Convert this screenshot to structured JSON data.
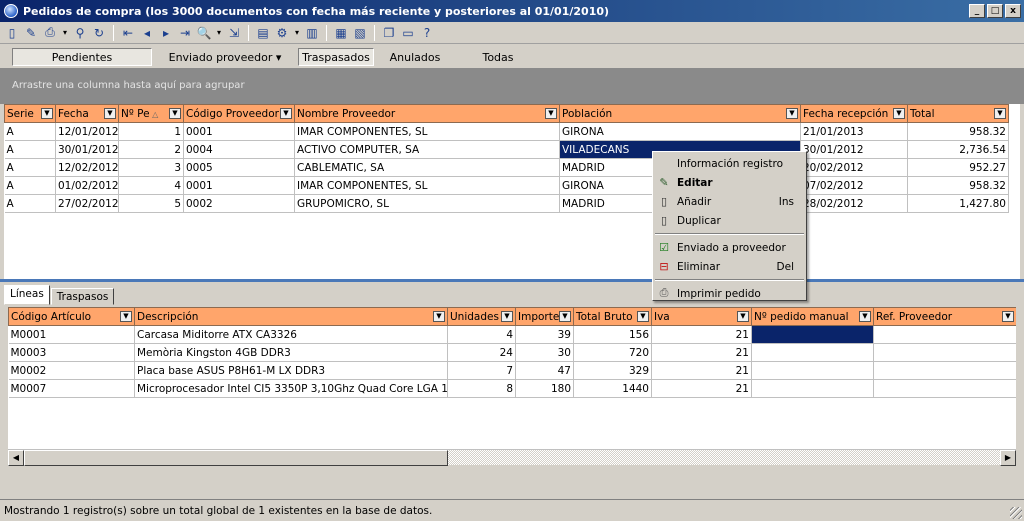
{
  "window": {
    "title": "Pedidos de compra (los 3000 documentos con fecha más reciente y posteriores al 01/01/2010)",
    "controls": [
      "_",
      "□",
      "x"
    ]
  },
  "toolbar_icons": [
    "new-doc-icon",
    "edit-icon",
    "print-icon",
    "caret",
    "link-icon",
    "refresh-icon",
    "sep",
    "first-icon",
    "prev-icon",
    "next-icon",
    "last-icon",
    "preview-icon",
    "caret",
    "export-icon",
    "sep",
    "report-icon",
    "tools-icon",
    "caret",
    "columns-icon",
    "sep",
    "grid-icon",
    "layout-icon",
    "sep",
    "window-icon",
    "window2-icon",
    "help-icon"
  ],
  "filter_tabs": [
    {
      "label": "Pendientes",
      "active": true
    },
    {
      "label": "Enviado proveedor ▾",
      "active": false
    },
    {
      "label": "Traspasados",
      "active": true
    },
    {
      "label": "Anulados",
      "active": false
    },
    {
      "label": "Todas",
      "active": false
    }
  ],
  "groupbar_text": "Arrastre una columna hasta aquí para agrupar",
  "orders": {
    "columns": [
      "Serie",
      "Fecha",
      "Nº Pe",
      "Código Proveedor",
      "Nombre Proveedor",
      "Población",
      "Fecha recepción",
      "Total"
    ],
    "sort_indicator": "△",
    "rows": [
      [
        "A",
        "12/01/2012",
        "1",
        "0001",
        "IMAR COMPONENTES, SL",
        "GIRONA",
        "21/01/2013",
        "958.32"
      ],
      [
        "A",
        "30/01/2012",
        "2",
        "0004",
        "ACTIVO COMPUTER, SA",
        "VILADECANS",
        "30/01/2012",
        "2,736.54"
      ],
      [
        "A",
        "12/02/2012",
        "3",
        "0005",
        "CABLEMATIC, SA",
        "MADRID",
        "20/02/2012",
        "952.27"
      ],
      [
        "A",
        "01/02/2012",
        "4",
        "0001",
        "IMAR COMPONENTES, SL",
        "GIRONA",
        "07/02/2012",
        "958.32"
      ],
      [
        "A",
        "27/02/2012",
        "5",
        "0002",
        "GRUPOMICRO, SL",
        "MADRID",
        "28/02/2012",
        "1,427.80"
      ]
    ]
  },
  "sub_tabs": [
    {
      "label": "Líneas",
      "active": true
    },
    {
      "label": "Traspasos",
      "active": false
    }
  ],
  "lines": {
    "columns": [
      "Código Artículo",
      "Descripción",
      "Unidades",
      "Importe",
      "Total Bruto",
      "Iva",
      "Nº pedido manual",
      "Ref. Proveedor"
    ],
    "rows": [
      [
        "M0001",
        "Carcasa Miditorre ATX CA3326",
        "4",
        "39",
        "156",
        "21",
        "",
        ""
      ],
      [
        "M0003",
        "Memòria Kingston 4GB DDR3",
        "24",
        "30",
        "720",
        "21",
        "",
        ""
      ],
      [
        "M0002",
        "Placa base ASUS P8H61-M LX DDR3",
        "7",
        "47",
        "329",
        "21",
        "",
        ""
      ],
      [
        "M0007",
        "Microprocesador Intel CI5 3350P 3,10Ghz Quad Core LGA 1155",
        "8",
        "180",
        "1440",
        "21",
        "",
        ""
      ]
    ]
  },
  "context_menu": [
    {
      "label": "Información registro",
      "shortcut": "",
      "icon": "",
      "bold": false
    },
    {
      "label": "Editar",
      "shortcut": "",
      "icon": "edit-icon",
      "bold": true
    },
    {
      "label": "Añadir",
      "shortcut": "Ins",
      "icon": "page-icon",
      "bold": false
    },
    {
      "label": "Duplicar",
      "shortcut": "",
      "icon": "page-icon",
      "bold": false
    },
    {
      "separator": true
    },
    {
      "label": "Enviado a proveedor",
      "shortcut": "",
      "icon": "check-icon",
      "bold": false
    },
    {
      "label": "Eliminar",
      "shortcut": "Del",
      "icon": "delete-icon",
      "bold": false
    },
    {
      "separator": true
    },
    {
      "label": "Imprimir pedido",
      "shortcut": "",
      "icon": "print-icon",
      "bold": false
    }
  ],
  "status": "Mostrando 1 registro(s) sobre un total global de 1 existentes en la base de datos."
}
